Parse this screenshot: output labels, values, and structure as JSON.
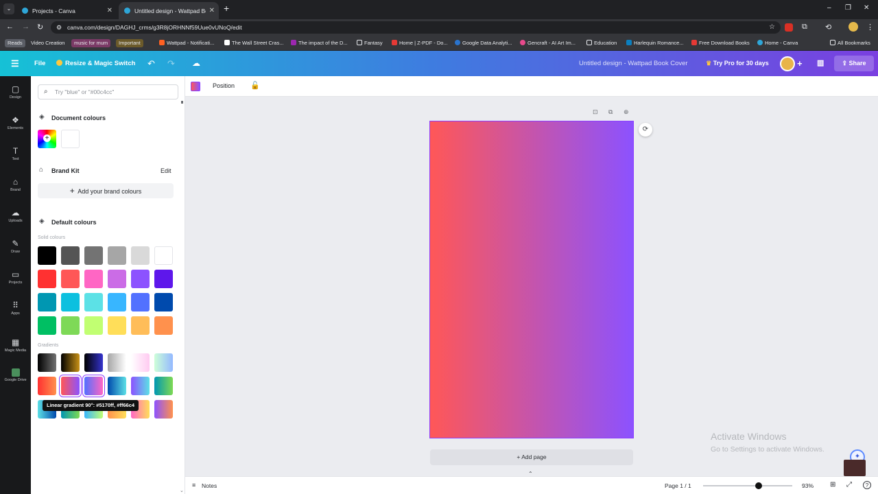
{
  "browser": {
    "tabs": [
      {
        "title": "Projects - Canva"
      },
      {
        "title": "Untitled design - Wattpad Book"
      }
    ],
    "url": "canva.com/design/DAGHJ_crms/g3R8jORHNNf59Uue0vUNoQ/edit",
    "bookmarks": [
      {
        "label": "Reads"
      },
      {
        "label": "Video Creation"
      },
      {
        "label": "music for mum"
      },
      {
        "label": "Important"
      },
      {
        "label": "Wattpad - Notificati..."
      },
      {
        "label": "The Wall Street Cras..."
      },
      {
        "label": "The impact of the D..."
      },
      {
        "label": "Fantasy"
      },
      {
        "label": "Home | Z-PDF - Do..."
      },
      {
        "label": "Google Data Analyti..."
      },
      {
        "label": "Gencraft - AI Art Im..."
      },
      {
        "label": "Education"
      },
      {
        "label": "Harlequin Romance..."
      },
      {
        "label": "Free Download Books"
      },
      {
        "label": "Home - Canva"
      }
    ],
    "all_bookmarks": "All Bookmarks"
  },
  "header": {
    "file": "File",
    "resize": "Resize & Magic Switch",
    "title": "Untitled design - Wattpad Book Cover",
    "try_pro": "Try Pro for 30 days",
    "share": "Share"
  },
  "rail": [
    {
      "label": "Design"
    },
    {
      "label": "Elements"
    },
    {
      "label": "Text"
    },
    {
      "label": "Brand"
    },
    {
      "label": "Uploads"
    },
    {
      "label": "Draw"
    },
    {
      "label": "Projects"
    },
    {
      "label": "Apps"
    },
    {
      "label": "Magic Media"
    },
    {
      "label": "Google Drive"
    }
  ],
  "panel": {
    "search_placeholder": "Try \"blue\" or \"#00c4cc\"",
    "document_colours": "Document colours",
    "brand_kit": "Brand Kit",
    "edit": "Edit",
    "add_brand": "Add your brand colours",
    "default_colours": "Default colours",
    "solid_label": "Solid colours",
    "gradients_label": "Gradients",
    "tooltip": "Linear gradient 90°: #5170ff, #ff66c4",
    "solid_colours": [
      "#000000",
      "#545454",
      "#737373",
      "#a6a6a6",
      "#d9d9d9",
      "#ffffff",
      "#ff3131",
      "#ff5757",
      "#ff66c4",
      "#cb6ce6",
      "#8c52ff",
      "#5e17eb",
      "#0097b2",
      "#0cc0df",
      "#5ce1e6",
      "#38b6ff",
      "#5271ff",
      "#004aad",
      "#00bf63",
      "#7ed957",
      "#c1ff72",
      "#ffde59",
      "#ffbd59",
      "#ff914d"
    ],
    "gradients": [
      [
        "#000000",
        "#737373"
      ],
      [
        "#000000",
        "#c89116"
      ],
      [
        "#000000",
        "#3533cd"
      ],
      [
        "#a6a6a6",
        "#ffffff"
      ],
      [
        "#ffffff",
        "#ffcaf1"
      ],
      [
        "#cdffd8",
        "#94b9ff"
      ],
      [
        "#ff3131",
        "#ff914d"
      ],
      [
        "#ff5757",
        "#8c52ff"
      ],
      [
        "#5170ff",
        "#ff66c4"
      ],
      [
        "#004aad",
        "#5de0e6"
      ],
      [
        "#8c52ff",
        "#5ce1e6"
      ],
      [
        "#0097b2",
        "#7ed952"
      ],
      [
        "#5de0e6",
        "#004aad"
      ],
      [
        "#0097b2",
        "#7ed952"
      ],
      [
        "#38b6ff",
        "#c1ff72"
      ],
      [
        "#ff914d",
        "#ffde59"
      ],
      [
        "#ff66c4",
        "#ffde59"
      ],
      [
        "#8c52ff",
        "#ff914d"
      ]
    ]
  },
  "context": {
    "position": "Position"
  },
  "canvas": {
    "gradient_from": "#ff5757",
    "gradient_to": "#8c52ff",
    "add_page": "+ Add page"
  },
  "watermark": {
    "line1": "Activate Windows",
    "line2": "Go to Settings to activate Windows."
  },
  "footer": {
    "notes": "Notes",
    "page": "Page 1 / 1",
    "zoom": "93%",
    "zoom_level": 0.62
  }
}
